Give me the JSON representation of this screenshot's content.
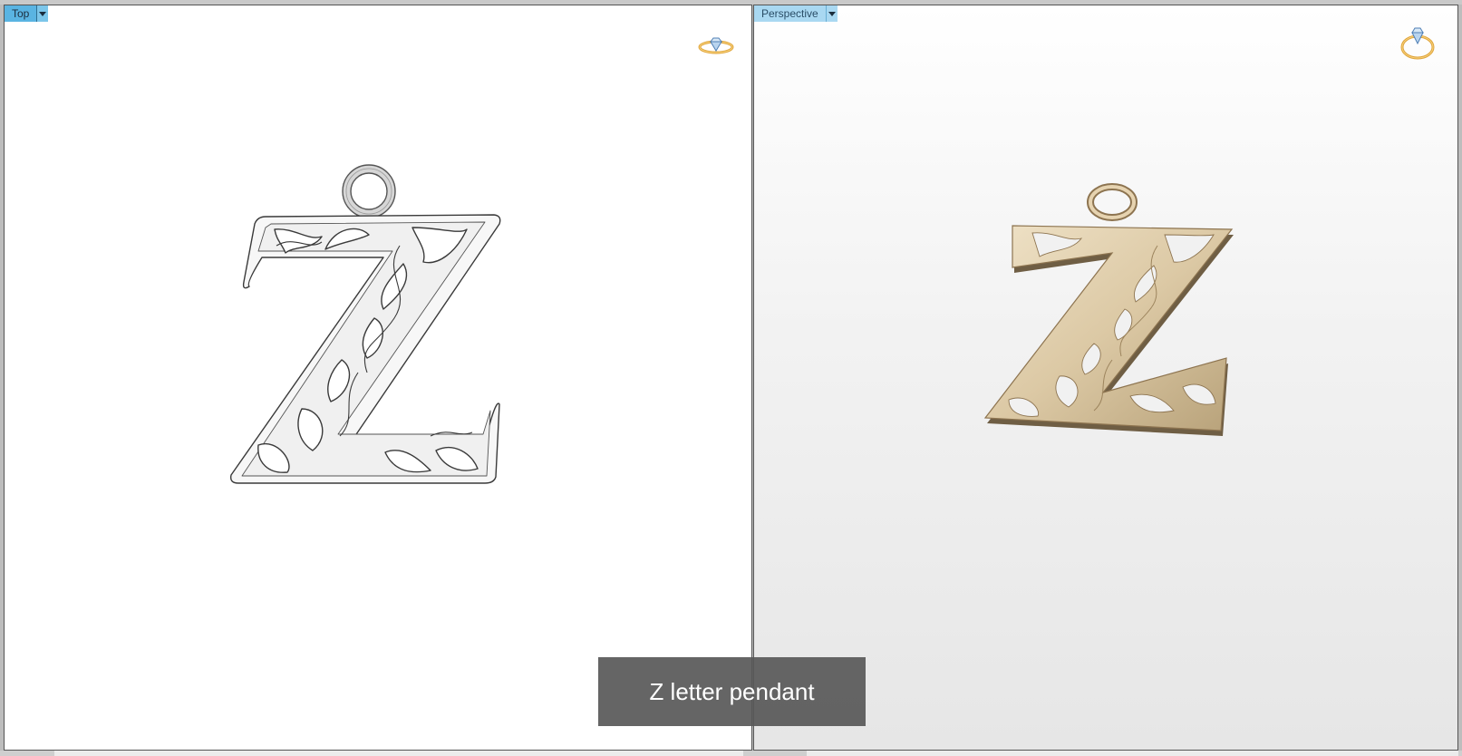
{
  "viewports": {
    "left": {
      "label": "Top",
      "menu_icon": "chevron-down-icon",
      "display_icon": "ring-diamond-icon"
    },
    "right": {
      "label": "Perspective",
      "menu_icon": "chevron-down-icon",
      "display_icon": "ring-diamond-icon"
    }
  },
  "models": {
    "left": {
      "shape": "z-letter-pendant-wireframe"
    },
    "right": {
      "shape": "z-letter-pendant-rendered-gold"
    }
  },
  "caption": "Z letter pendant",
  "colors": {
    "viewport_label_active": "#5ab4e2",
    "viewport_label_inactive": "#a9d8f1",
    "metal_gold": "#d9c8a6",
    "caption_background": "#585858"
  }
}
